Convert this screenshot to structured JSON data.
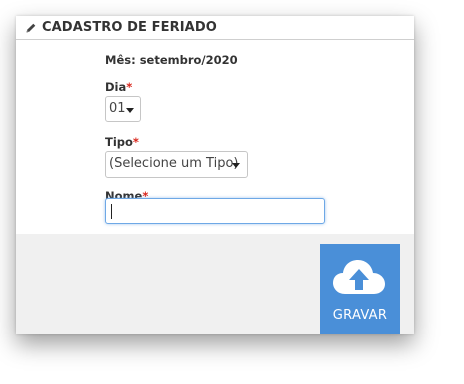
{
  "header": {
    "title": "CADASTRO DE FERIADO",
    "icon": "pencil-icon"
  },
  "form": {
    "month_text": "Mês: setembro/2020",
    "dia": {
      "label": "Dia",
      "required_mark": "*",
      "value": "01"
    },
    "tipo": {
      "label": "Tipo",
      "required_mark": "*",
      "value": "(Selecione um Tipo)"
    },
    "nome": {
      "label": "Nome",
      "required_mark": "*",
      "value": ""
    }
  },
  "actions": {
    "save_label": "GRAVAR",
    "save_icon": "cloud-upload-icon",
    "save_color": "#4a8fd8"
  },
  "colors": {
    "required": "#d9261c",
    "footer_bg": "#f0f0f0",
    "focus_border": "#6ea8e6"
  }
}
